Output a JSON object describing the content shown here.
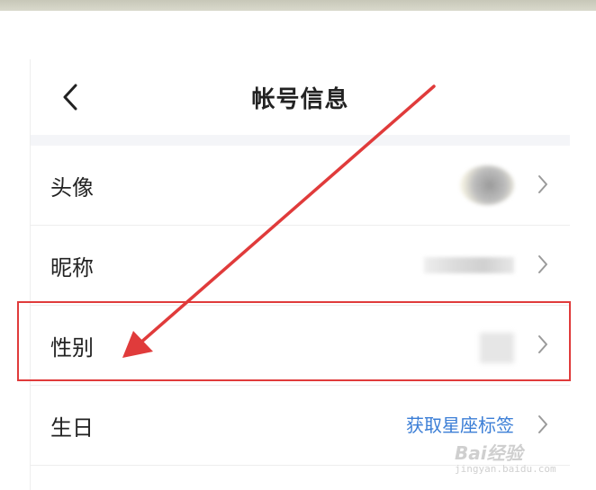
{
  "header": {
    "title": "帐号信息",
    "back_icon": "chevron-left-icon"
  },
  "rows": [
    {
      "label": "头像",
      "value": "",
      "value_type": "blurred-avatar"
    },
    {
      "label": "昵称",
      "value": "",
      "value_type": "blurred-text"
    },
    {
      "label": "性别",
      "value": "",
      "value_type": "blurred-text"
    },
    {
      "label": "生日",
      "value": "获取星座标签",
      "value_type": "link"
    }
  ],
  "annotation": {
    "highlighted_row": "性别",
    "color": "#e03b3b"
  },
  "watermark": {
    "logo": "Bai经验",
    "url": "jingyan.baidu.com"
  },
  "colors": {
    "accent_link": "#3b7ed6",
    "separator": "#f4f5f8"
  }
}
